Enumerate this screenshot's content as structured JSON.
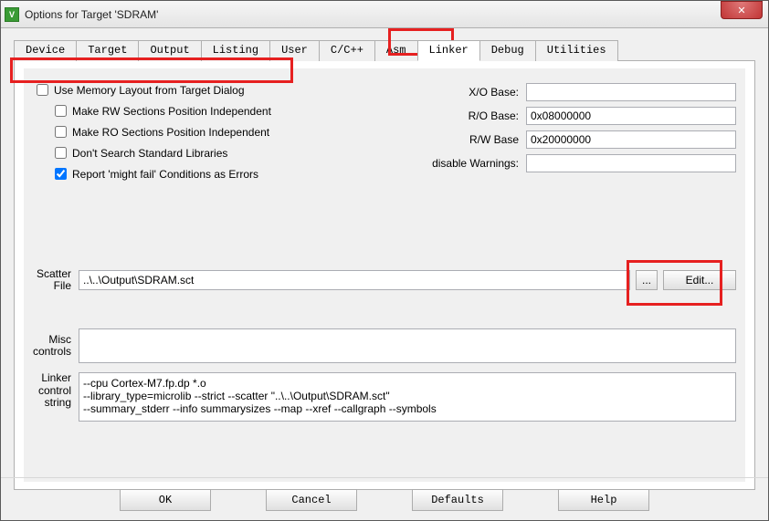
{
  "window": {
    "title": "Options for Target 'SDRAM'"
  },
  "tabs": {
    "device": "Device",
    "target": "Target",
    "output": "Output",
    "listing": "Listing",
    "user": "User",
    "ccpp": "C/C++",
    "asm": "Asm",
    "linker": "Linker",
    "debug": "Debug",
    "utilities": "Utilities"
  },
  "linker": {
    "use_memory_layout": "Use Memory Layout from Target Dialog",
    "make_rw": "Make RW Sections Position Independent",
    "make_ro": "Make RO Sections Position Independent",
    "dont_search": "Don't Search Standard Libraries",
    "report_might_fail": "Report 'might fail' Conditions as Errors",
    "xo_base_label": "X/O Base:",
    "xo_base_value": "",
    "ro_base_label": "R/O Base:",
    "ro_base_value": "0x08000000",
    "rw_base_label": "R/W Base",
    "rw_base_value": "0x20000000",
    "disable_warnings_label": "disable Warnings:",
    "disable_warnings_value": "",
    "scatter_file_label": "Scatter\nFile",
    "scatter_file_value": "..\\..\\Output\\SDRAM.sct",
    "browse": "...",
    "edit": "Edit...",
    "misc_label": "Misc\ncontrols",
    "misc_value": "",
    "ctrl_label": "Linker\ncontrol\nstring",
    "ctrl_value": "--cpu Cortex-M7.fp.dp *.o\n--library_type=microlib --strict --scatter \"..\\..\\Output\\SDRAM.sct\"\n--summary_stderr --info summarysizes --map --xref --callgraph --symbols"
  },
  "buttons": {
    "ok": "OK",
    "cancel": "Cancel",
    "defaults": "Defaults",
    "help": "Help"
  }
}
